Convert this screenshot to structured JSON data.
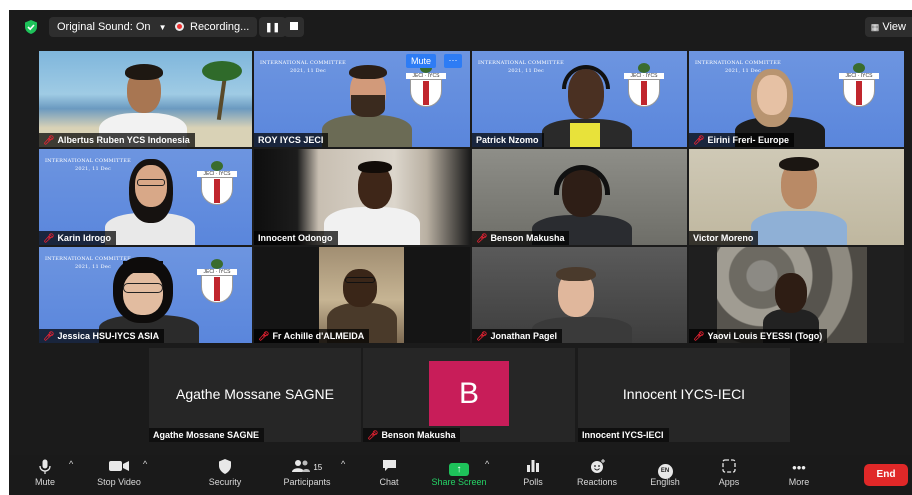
{
  "topbar": {
    "original_sound": "Original Sound: On",
    "recording": "Recording...",
    "pause_icon": "pause-icon",
    "stop_icon": "stop-icon",
    "view_label": "View"
  },
  "tiles": [
    {
      "name": "Albertus  Ruben YCS Indonesia",
      "muted": true
    },
    {
      "name": "ROY IYCS JECI",
      "muted": false,
      "active": true,
      "mute_button": "Mute",
      "more_button": "···"
    },
    {
      "name": "Patrick Nzomo",
      "muted": false
    },
    {
      "name": "Eirini Freri- Europe",
      "muted": true
    },
    {
      "name": "Karin Idrogo",
      "muted": true
    },
    {
      "name": "Innocent Odongo",
      "muted": false
    },
    {
      "name": "Benson Makusha",
      "muted": true
    },
    {
      "name": "Victor Moreno",
      "muted": false
    },
    {
      "name": "Jessica HSU-IYCS ASIA",
      "muted": true
    },
    {
      "name": "Fr Achille d'ALMEIDA",
      "muted": true
    },
    {
      "name": "Jonathan Pagel",
      "muted": true
    },
    {
      "name": "Yaovi Louis EYESSI (Togo)",
      "muted": true
    }
  ],
  "slide": {
    "line1": "INTERNATIONAL COMMITTEE",
    "line2": "2021, 11 Dec",
    "emblem_label": "JECI · IYCS"
  },
  "name_tiles": [
    {
      "display": "Agathe Mossane SAGNE",
      "label": "Agathe Mossane SAGNE",
      "muted": false
    },
    {
      "display": "B",
      "label": "Benson Makusha",
      "muted": true,
      "avatar_color": "#c81d59"
    },
    {
      "display": "Innocent IYCS-IECI",
      "label": "Innocent IYCS-IECI",
      "muted": false
    }
  ],
  "toolbar": {
    "mute": "Mute",
    "stop_video": "Stop Video",
    "security": "Security",
    "participants": "Participants",
    "participants_count": "15",
    "chat": "Chat",
    "share_screen": "Share Screen",
    "polls": "Polls",
    "reactions": "Reactions",
    "english": "English",
    "english_badge": "EN",
    "apps": "Apps",
    "more": "More",
    "end": "End"
  },
  "colors": {
    "background": "#1b1b1b",
    "active_speaker": "#c8e04a",
    "share_green": "#1ec25a",
    "end_red": "#e02828",
    "muted_mic": "#e22233",
    "avatar_pink": "#c81d59",
    "slide_blue": "#5a86dc"
  }
}
